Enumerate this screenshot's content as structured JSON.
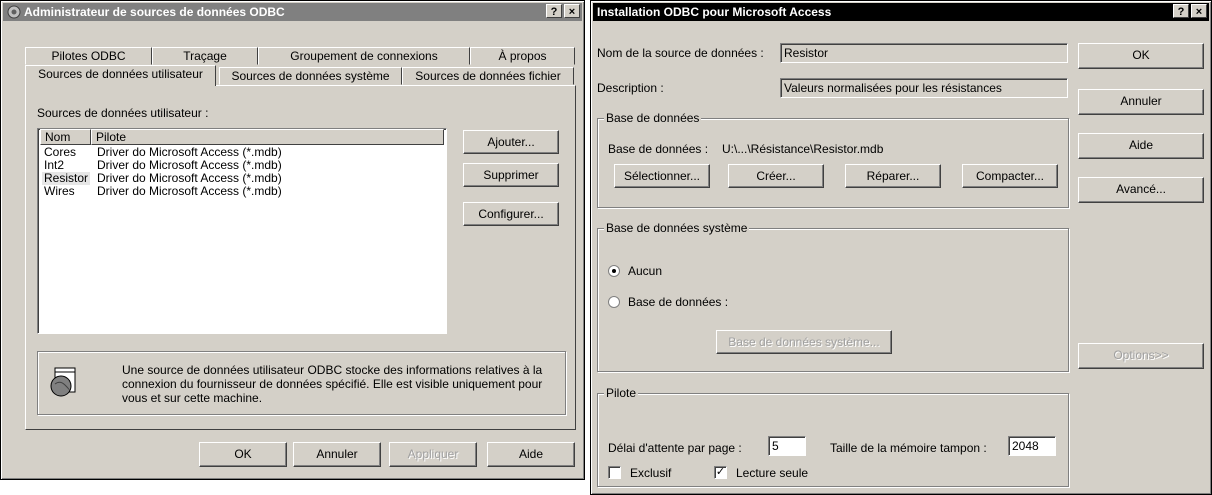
{
  "left": {
    "title": "Administrateur de sources de données ODBC",
    "help_button": "?",
    "close_button": "×",
    "tabs_back": [
      "Pilotes ODBC",
      "Traçage",
      "Groupement de connexions",
      "À propos"
    ],
    "tabs_front": [
      "Sources de données utilisateur",
      "Sources de données système",
      "Sources de données fichier"
    ],
    "section_label": "Sources de données utilisateur :",
    "columns": [
      "Nom",
      "Pilote"
    ],
    "rows": [
      {
        "name": "Cores",
        "driver": "Driver do Microsoft Access (*.mdb)"
      },
      {
        "name": "Int2",
        "driver": "Driver do Microsoft Access (*.mdb)"
      },
      {
        "name": "Resistor",
        "driver": "Driver do Microsoft Access (*.mdb)"
      },
      {
        "name": "Wires",
        "driver": "Driver do Microsoft Access (*.mdb)"
      }
    ],
    "buttons": {
      "add": "Ajouter...",
      "remove": "Supprimer",
      "configure": "Configurer..."
    },
    "info_text": "Une source de données utilisateur ODBC stocke des informations relatives à la connexion du fournisseur de données spécifié. Elle est visible uniquement pour vous et sur cette machine.",
    "bottom": {
      "ok": "OK",
      "cancel": "Annuler",
      "apply": "Appliquer",
      "help": "Aide"
    }
  },
  "right": {
    "title": "Installation ODBC pour Microsoft Access",
    "help_button": "?",
    "close_button": "×",
    "dsn_label": "Nom de la source de données :",
    "dsn_value": "Resistor",
    "desc_label": "Description :",
    "desc_value": "Valeurs normalisées pour les résistances",
    "db_group": "Base de données",
    "db_path_label": "Base de données :",
    "db_path": "U:\\...\\Résistance\\Resistor.mdb",
    "db_buttons": [
      "Sélectionner...",
      "Créer...",
      "Réparer...",
      "Compacter..."
    ],
    "sys_group": "Base de données système",
    "radio_none": "Aucun",
    "radio_db": "Base de données :",
    "sys_db_button": "Base de données système...",
    "driver_group": "Pilote",
    "timeout_label": "Délai d'attente par page :",
    "timeout_value": "5",
    "buffer_label": "Taille de la mémoire tampon :",
    "buffer_value": "2048",
    "exclusive_label": "Exclusif",
    "readonly_label": "Lecture seule",
    "side_buttons": {
      "ok": "OK",
      "cancel": "Annuler",
      "help": "Aide",
      "advanced": "Avancé...",
      "options": "Options>>"
    }
  }
}
